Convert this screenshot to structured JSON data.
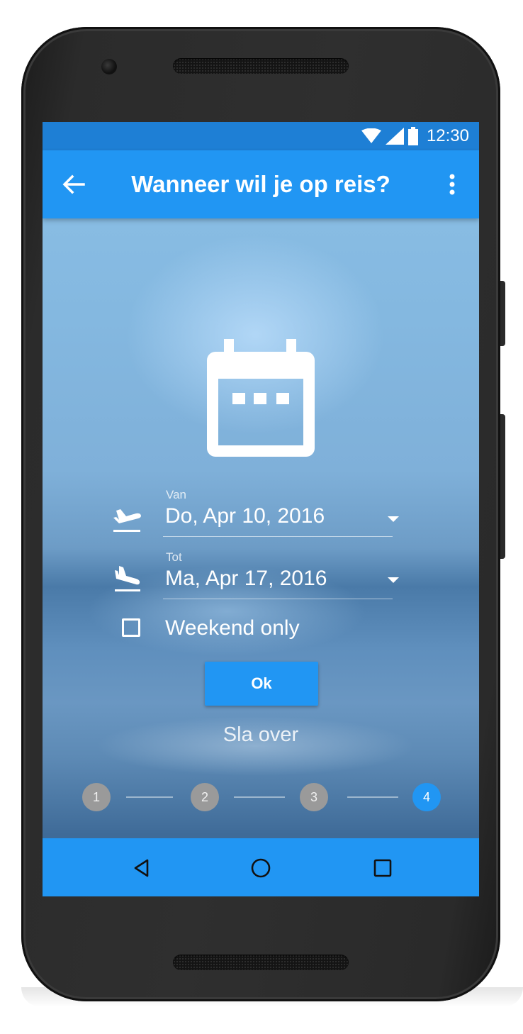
{
  "status_bar": {
    "time": "12:30",
    "icons": [
      "wifi-icon",
      "signal-icon",
      "battery-icon"
    ]
  },
  "app_bar": {
    "title": "Wanneer wil je op reis?",
    "back_icon": "arrow-back-icon",
    "menu_icon": "more-vert-icon"
  },
  "hero_icon": "calendar-icon",
  "date_fields": [
    {
      "label": "Van",
      "value": "Do, Apr 10, 2016",
      "icon": "flight-takeoff-icon"
    },
    {
      "label": "Tot",
      "value": "Ma, Apr 17, 2016",
      "icon": "flight-land-icon"
    }
  ],
  "weekend_only": {
    "label": "Weekend only",
    "checked": false
  },
  "ok_button": {
    "label": "Ok"
  },
  "skip_link": {
    "label": "Sla over"
  },
  "stepper": {
    "steps": [
      "1",
      "2",
      "3",
      "4"
    ],
    "active_step": "4"
  },
  "nav_bar": {
    "icons": [
      "nav-back-icon",
      "nav-home-icon",
      "nav-recents-icon"
    ]
  },
  "colors": {
    "primary": "#2196f3",
    "primary_dark": "#1e7fd5",
    "inactive_step": "#9a9a9a"
  }
}
